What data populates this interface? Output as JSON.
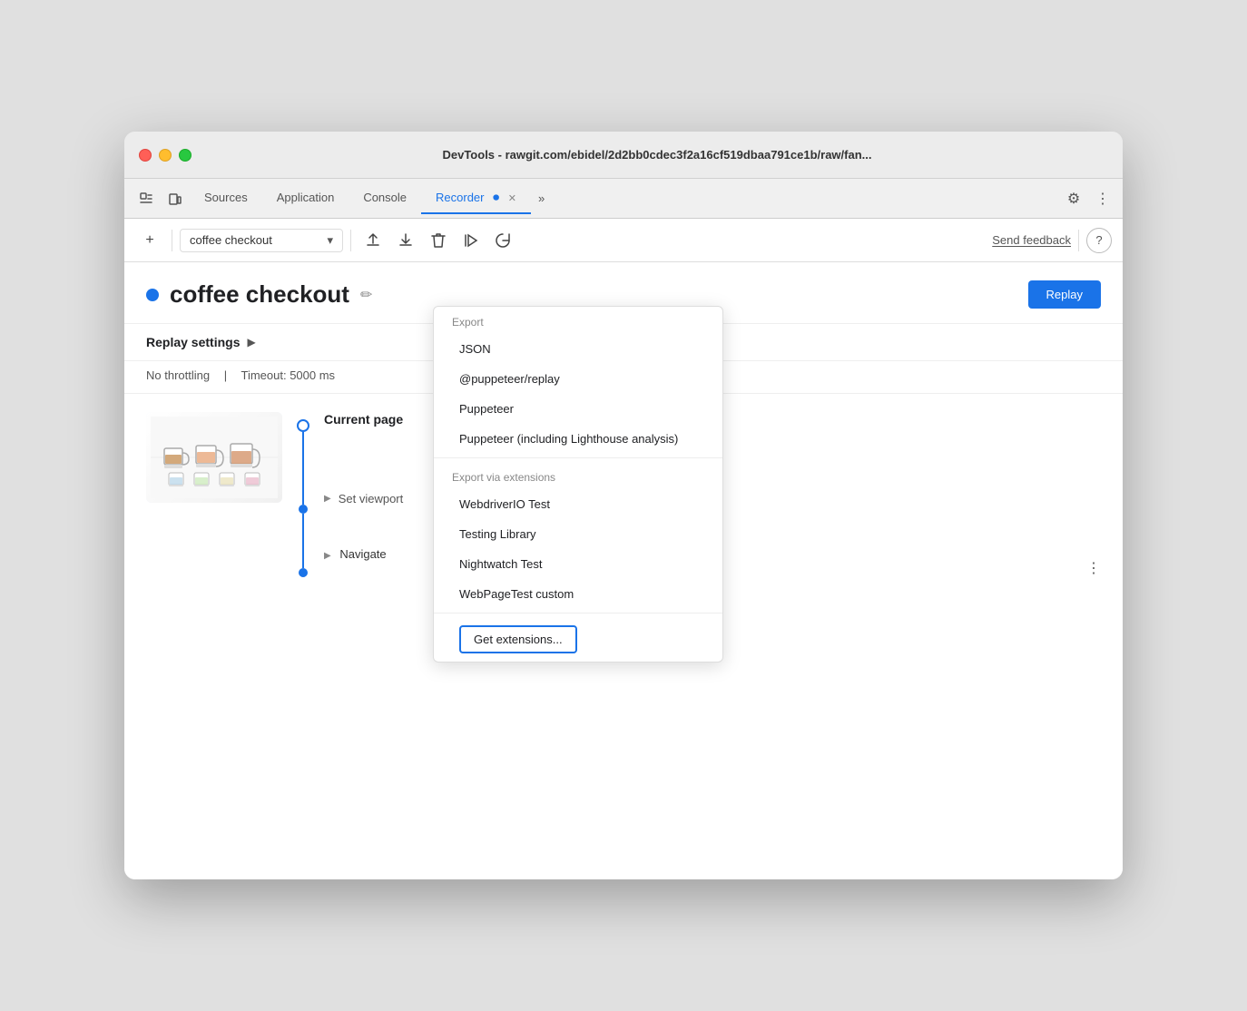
{
  "window": {
    "title": "DevTools - rawgit.com/ebidel/2d2bb0cdec3f2a16cf519dbaa791ce1b/raw/fan..."
  },
  "tabs": {
    "items": [
      {
        "label": "Sources",
        "active": false
      },
      {
        "label": "Application",
        "active": false
      },
      {
        "label": "Console",
        "active": false
      },
      {
        "label": "Recorder",
        "active": true
      }
    ],
    "overflow_label": "»",
    "settings_label": "⚙",
    "more_label": "⋮"
  },
  "toolbar": {
    "add_label": "+",
    "recording_name": "coffee checkout",
    "chevron": "▾",
    "upload_label": "↑",
    "download_label": "↓",
    "delete_label": "🗑",
    "play_label": "▷",
    "refresh_label": "↺",
    "send_feedback_label": "Send feedback",
    "help_label": "?"
  },
  "recording": {
    "title": "coffee checkout",
    "edit_icon": "✏",
    "replay_button": "Replay"
  },
  "replay_settings": {
    "label": "Replay settings",
    "arrow": "▶",
    "throttling": "No throttling",
    "timeout": "Timeout: 5000 ms"
  },
  "steps": {
    "current_page_label": "Current page",
    "set_viewport_label": "Set viewport",
    "navigate_label": "Navigate"
  },
  "export_dropdown": {
    "export_label": "Export",
    "items": [
      {
        "label": "JSON",
        "id": "json"
      },
      {
        "label": "@puppeteer/replay",
        "id": "puppeteer-replay"
      },
      {
        "label": "Puppeteer",
        "id": "puppeteer"
      },
      {
        "label": "Puppeteer (including Lighthouse analysis)",
        "id": "puppeteer-lighthouse"
      }
    ],
    "export_via_label": "Export via extensions",
    "extension_items": [
      {
        "label": "WebdriverIO Test",
        "id": "webdriverio"
      },
      {
        "label": "Testing Library",
        "id": "testing-library"
      },
      {
        "label": "Nightwatch Test",
        "id": "nightwatch"
      },
      {
        "label": "WebPageTest custom",
        "id": "webpagetest"
      }
    ],
    "get_extensions_label": "Get extensions..."
  },
  "colors": {
    "accent": "#1a73e8",
    "text_primary": "#202124",
    "text_secondary": "#555",
    "border": "#ddd",
    "bg_toolbar": "#f0f0f0",
    "bg_main": "#fff"
  }
}
